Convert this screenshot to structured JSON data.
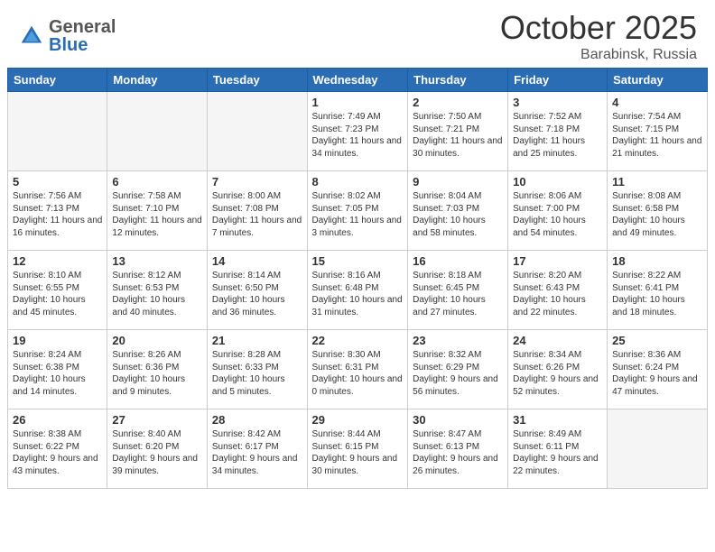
{
  "header": {
    "logo_general": "General",
    "logo_blue": "Blue",
    "month": "October 2025",
    "location": "Barabinsk, Russia"
  },
  "weekdays": [
    "Sunday",
    "Monday",
    "Tuesday",
    "Wednesday",
    "Thursday",
    "Friday",
    "Saturday"
  ],
  "weeks": [
    [
      {
        "day": "",
        "info": ""
      },
      {
        "day": "",
        "info": ""
      },
      {
        "day": "",
        "info": ""
      },
      {
        "day": "1",
        "info": "Sunrise: 7:49 AM\nSunset: 7:23 PM\nDaylight: 11 hours\nand 34 minutes."
      },
      {
        "day": "2",
        "info": "Sunrise: 7:50 AM\nSunset: 7:21 PM\nDaylight: 11 hours\nand 30 minutes."
      },
      {
        "day": "3",
        "info": "Sunrise: 7:52 AM\nSunset: 7:18 PM\nDaylight: 11 hours\nand 25 minutes."
      },
      {
        "day": "4",
        "info": "Sunrise: 7:54 AM\nSunset: 7:15 PM\nDaylight: 11 hours\nand 21 minutes."
      }
    ],
    [
      {
        "day": "5",
        "info": "Sunrise: 7:56 AM\nSunset: 7:13 PM\nDaylight: 11 hours\nand 16 minutes."
      },
      {
        "day": "6",
        "info": "Sunrise: 7:58 AM\nSunset: 7:10 PM\nDaylight: 11 hours\nand 12 minutes."
      },
      {
        "day": "7",
        "info": "Sunrise: 8:00 AM\nSunset: 7:08 PM\nDaylight: 11 hours\nand 7 minutes."
      },
      {
        "day": "8",
        "info": "Sunrise: 8:02 AM\nSunset: 7:05 PM\nDaylight: 11 hours\nand 3 minutes."
      },
      {
        "day": "9",
        "info": "Sunrise: 8:04 AM\nSunset: 7:03 PM\nDaylight: 10 hours\nand 58 minutes."
      },
      {
        "day": "10",
        "info": "Sunrise: 8:06 AM\nSunset: 7:00 PM\nDaylight: 10 hours\nand 54 minutes."
      },
      {
        "day": "11",
        "info": "Sunrise: 8:08 AM\nSunset: 6:58 PM\nDaylight: 10 hours\nand 49 minutes."
      }
    ],
    [
      {
        "day": "12",
        "info": "Sunrise: 8:10 AM\nSunset: 6:55 PM\nDaylight: 10 hours\nand 45 minutes."
      },
      {
        "day": "13",
        "info": "Sunrise: 8:12 AM\nSunset: 6:53 PM\nDaylight: 10 hours\nand 40 minutes."
      },
      {
        "day": "14",
        "info": "Sunrise: 8:14 AM\nSunset: 6:50 PM\nDaylight: 10 hours\nand 36 minutes."
      },
      {
        "day": "15",
        "info": "Sunrise: 8:16 AM\nSunset: 6:48 PM\nDaylight: 10 hours\nand 31 minutes."
      },
      {
        "day": "16",
        "info": "Sunrise: 8:18 AM\nSunset: 6:45 PM\nDaylight: 10 hours\nand 27 minutes."
      },
      {
        "day": "17",
        "info": "Sunrise: 8:20 AM\nSunset: 6:43 PM\nDaylight: 10 hours\nand 22 minutes."
      },
      {
        "day": "18",
        "info": "Sunrise: 8:22 AM\nSunset: 6:41 PM\nDaylight: 10 hours\nand 18 minutes."
      }
    ],
    [
      {
        "day": "19",
        "info": "Sunrise: 8:24 AM\nSunset: 6:38 PM\nDaylight: 10 hours\nand 14 minutes."
      },
      {
        "day": "20",
        "info": "Sunrise: 8:26 AM\nSunset: 6:36 PM\nDaylight: 10 hours\nand 9 minutes."
      },
      {
        "day": "21",
        "info": "Sunrise: 8:28 AM\nSunset: 6:33 PM\nDaylight: 10 hours\nand 5 minutes."
      },
      {
        "day": "22",
        "info": "Sunrise: 8:30 AM\nSunset: 6:31 PM\nDaylight: 10 hours\nand 0 minutes."
      },
      {
        "day": "23",
        "info": "Sunrise: 8:32 AM\nSunset: 6:29 PM\nDaylight: 9 hours\nand 56 minutes."
      },
      {
        "day": "24",
        "info": "Sunrise: 8:34 AM\nSunset: 6:26 PM\nDaylight: 9 hours\nand 52 minutes."
      },
      {
        "day": "25",
        "info": "Sunrise: 8:36 AM\nSunset: 6:24 PM\nDaylight: 9 hours\nand 47 minutes."
      }
    ],
    [
      {
        "day": "26",
        "info": "Sunrise: 8:38 AM\nSunset: 6:22 PM\nDaylight: 9 hours\nand 43 minutes."
      },
      {
        "day": "27",
        "info": "Sunrise: 8:40 AM\nSunset: 6:20 PM\nDaylight: 9 hours\nand 39 minutes."
      },
      {
        "day": "28",
        "info": "Sunrise: 8:42 AM\nSunset: 6:17 PM\nDaylight: 9 hours\nand 34 minutes."
      },
      {
        "day": "29",
        "info": "Sunrise: 8:44 AM\nSunset: 6:15 PM\nDaylight: 9 hours\nand 30 minutes."
      },
      {
        "day": "30",
        "info": "Sunrise: 8:47 AM\nSunset: 6:13 PM\nDaylight: 9 hours\nand 26 minutes."
      },
      {
        "day": "31",
        "info": "Sunrise: 8:49 AM\nSunset: 6:11 PM\nDaylight: 9 hours\nand 22 minutes."
      },
      {
        "day": "",
        "info": ""
      }
    ]
  ]
}
